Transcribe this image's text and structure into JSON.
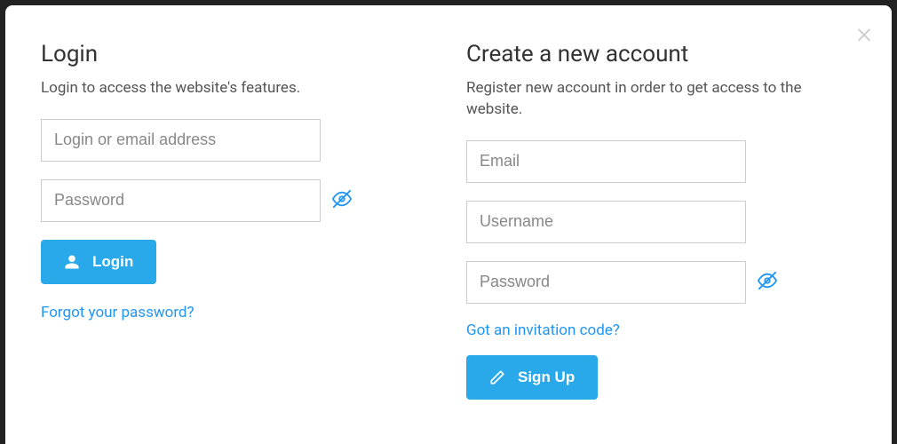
{
  "login": {
    "title": "Login",
    "subtitle": "Login to access the website's features.",
    "login_placeholder": "Login or email address",
    "password_placeholder": "Password",
    "button_label": "Login",
    "forgot_link": "Forgot your password?"
  },
  "register": {
    "title": "Create a new account",
    "subtitle": "Register new account in order to get access to the website.",
    "email_placeholder": "Email",
    "username_placeholder": "Username",
    "password_placeholder": "Password",
    "invitation_link": "Got an invitation code?",
    "button_label": "Sign Up"
  }
}
